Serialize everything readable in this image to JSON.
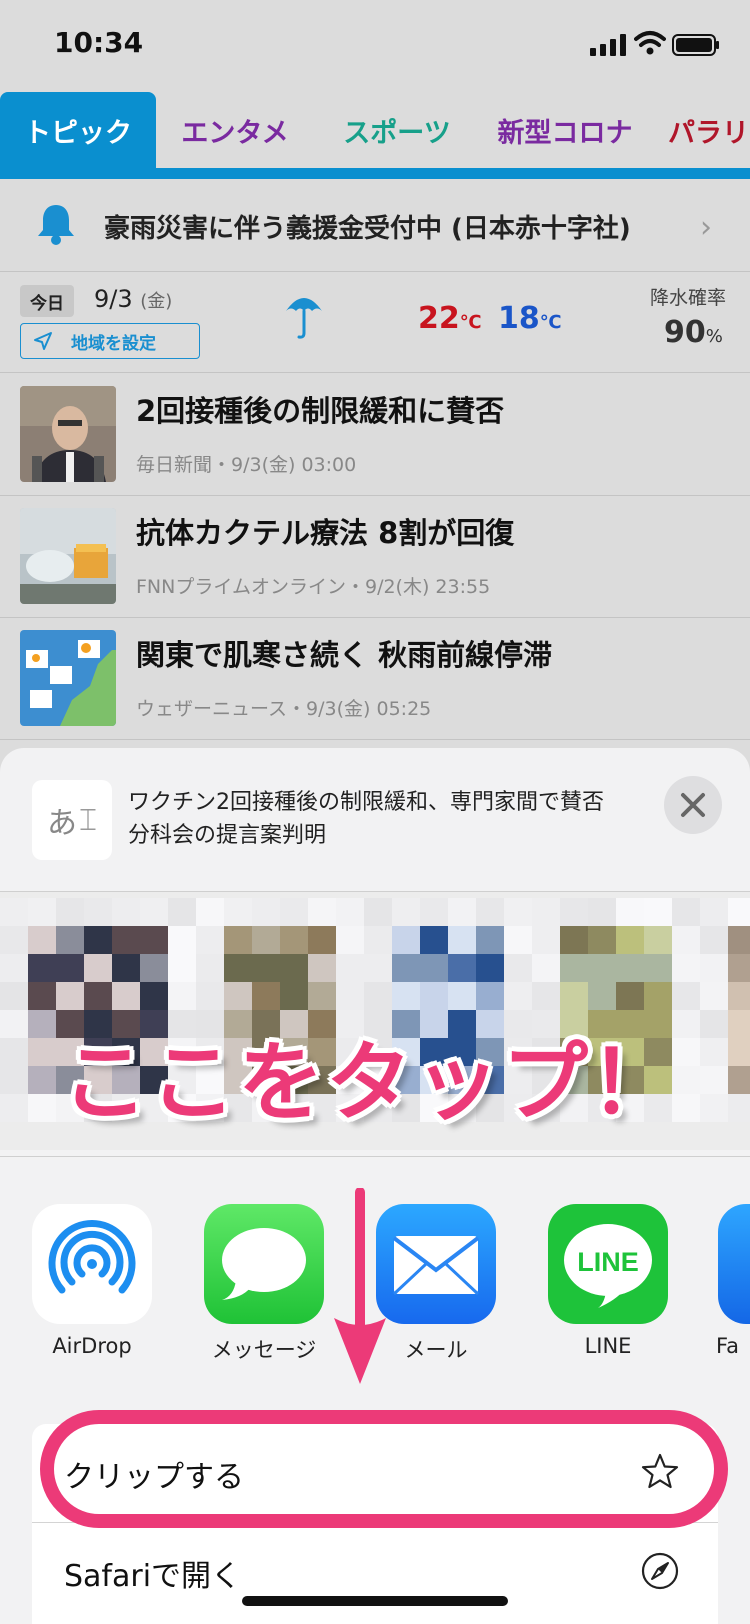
{
  "status_bar": {
    "time": "10:34"
  },
  "tabs": [
    {
      "label": "トピック",
      "color": "#ffffff"
    },
    {
      "label": "エンタメ",
      "color": "#7a2aa0"
    },
    {
      "label": "スポーツ",
      "color": "#17a08a"
    },
    {
      "label": "新型コロナ",
      "color": "#7a2aa0"
    },
    {
      "label": "パラリ",
      "color": "#b0162a"
    }
  ],
  "banner": {
    "text": "豪雨災害に伴う義援金受付中 (日本赤十字社)"
  },
  "weather": {
    "today_label": "今日",
    "date": "9/3",
    "weekday": "(金)",
    "set_area_label": "地域を設定",
    "high": "22",
    "low": "18",
    "unit": "℃",
    "rain_label": "降水確率",
    "rain_value": "90",
    "rain_unit": "%"
  },
  "news": [
    {
      "headline": "2回接種後の制限緩和に賛否",
      "meta": "毎日新聞・9/3(金) 03:00"
    },
    {
      "headline": "抗体カクテル療法 8割が回復",
      "meta": "FNNプライムオンライン・9/2(木) 23:55"
    },
    {
      "headline": "関東で肌寒さ続く 秋雨前線停滞",
      "meta": "ウェザーニュース・9/3(金) 05:25"
    }
  ],
  "share_sheet": {
    "preview_icon_text": "あ",
    "preview_title": "ワクチン2回接種後の制限緩和、専門家間で賛否 分科会の提言案判明",
    "annotation": "ここをタップ！",
    "apps": [
      {
        "label": "AirDrop",
        "icon": "airdrop-icon"
      },
      {
        "label": "メッセージ",
        "icon": "messages-icon"
      },
      {
        "label": "メール",
        "icon": "mail-icon"
      },
      {
        "label": "LINE",
        "icon": "line-icon",
        "icon_text": "LINE"
      },
      {
        "label": "Fa",
        "icon": "facebook-icon"
      }
    ],
    "actions": [
      {
        "label": "クリップする",
        "icon": "star-icon"
      },
      {
        "label": "Safariで開く",
        "icon": "compass-icon"
      }
    ]
  },
  "colors": {
    "accent": "#0a8fcf",
    "annotation": "#ec3a78"
  }
}
